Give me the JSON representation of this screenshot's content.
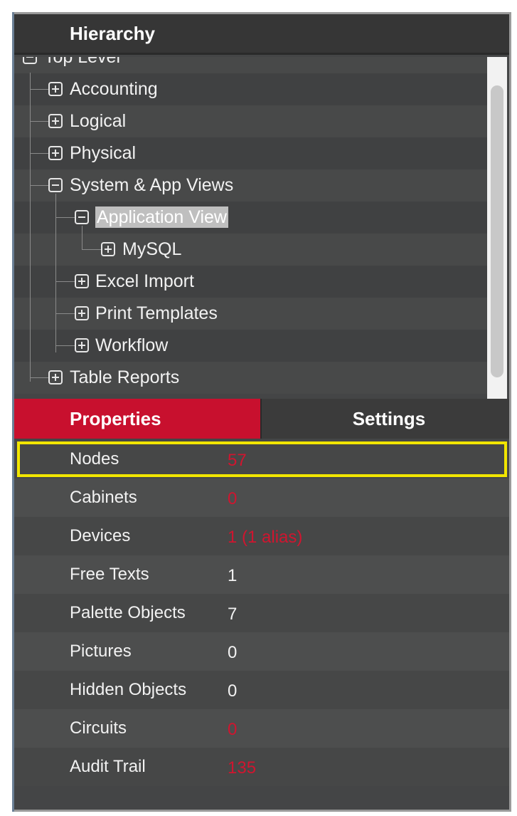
{
  "panel": {
    "title": "Hierarchy"
  },
  "tree": {
    "items": [
      {
        "label": "Top Level",
        "expanded": true
      },
      {
        "label": "Accounting",
        "expanded": false
      },
      {
        "label": "Logical",
        "expanded": false
      },
      {
        "label": "Physical",
        "expanded": false
      },
      {
        "label": "System & App Views",
        "expanded": true
      },
      {
        "label": "Application View",
        "expanded": true,
        "selected": true
      },
      {
        "label": "MySQL",
        "expanded": false
      },
      {
        "label": "Excel Import",
        "expanded": false
      },
      {
        "label": "Print Templates",
        "expanded": false
      },
      {
        "label": "Workflow",
        "expanded": false
      },
      {
        "label": "Table Reports",
        "expanded": false
      }
    ]
  },
  "tabs": {
    "properties": "Properties",
    "settings": "Settings",
    "active": "Properties"
  },
  "properties": {
    "rows": [
      {
        "name": "Nodes",
        "value": "57"
      },
      {
        "name": "Cabinets",
        "value": "0"
      },
      {
        "name": "Devices",
        "value": "1 (1 alias)"
      },
      {
        "name": "Free Texts",
        "value": "1"
      },
      {
        "name": "Palette Objects",
        "value": "7"
      },
      {
        "name": "Pictures",
        "value": "0"
      },
      {
        "name": "Hidden Objects",
        "value": "0"
      },
      {
        "name": "Circuits",
        "value": "0"
      },
      {
        "name": "Audit Trail",
        "value": "135"
      }
    ]
  },
  "colors": {
    "accent_red": "#c8102e",
    "value_red": "#d0152f",
    "highlight_yellow": "#f2e600",
    "panel_bg": "#444546"
  }
}
